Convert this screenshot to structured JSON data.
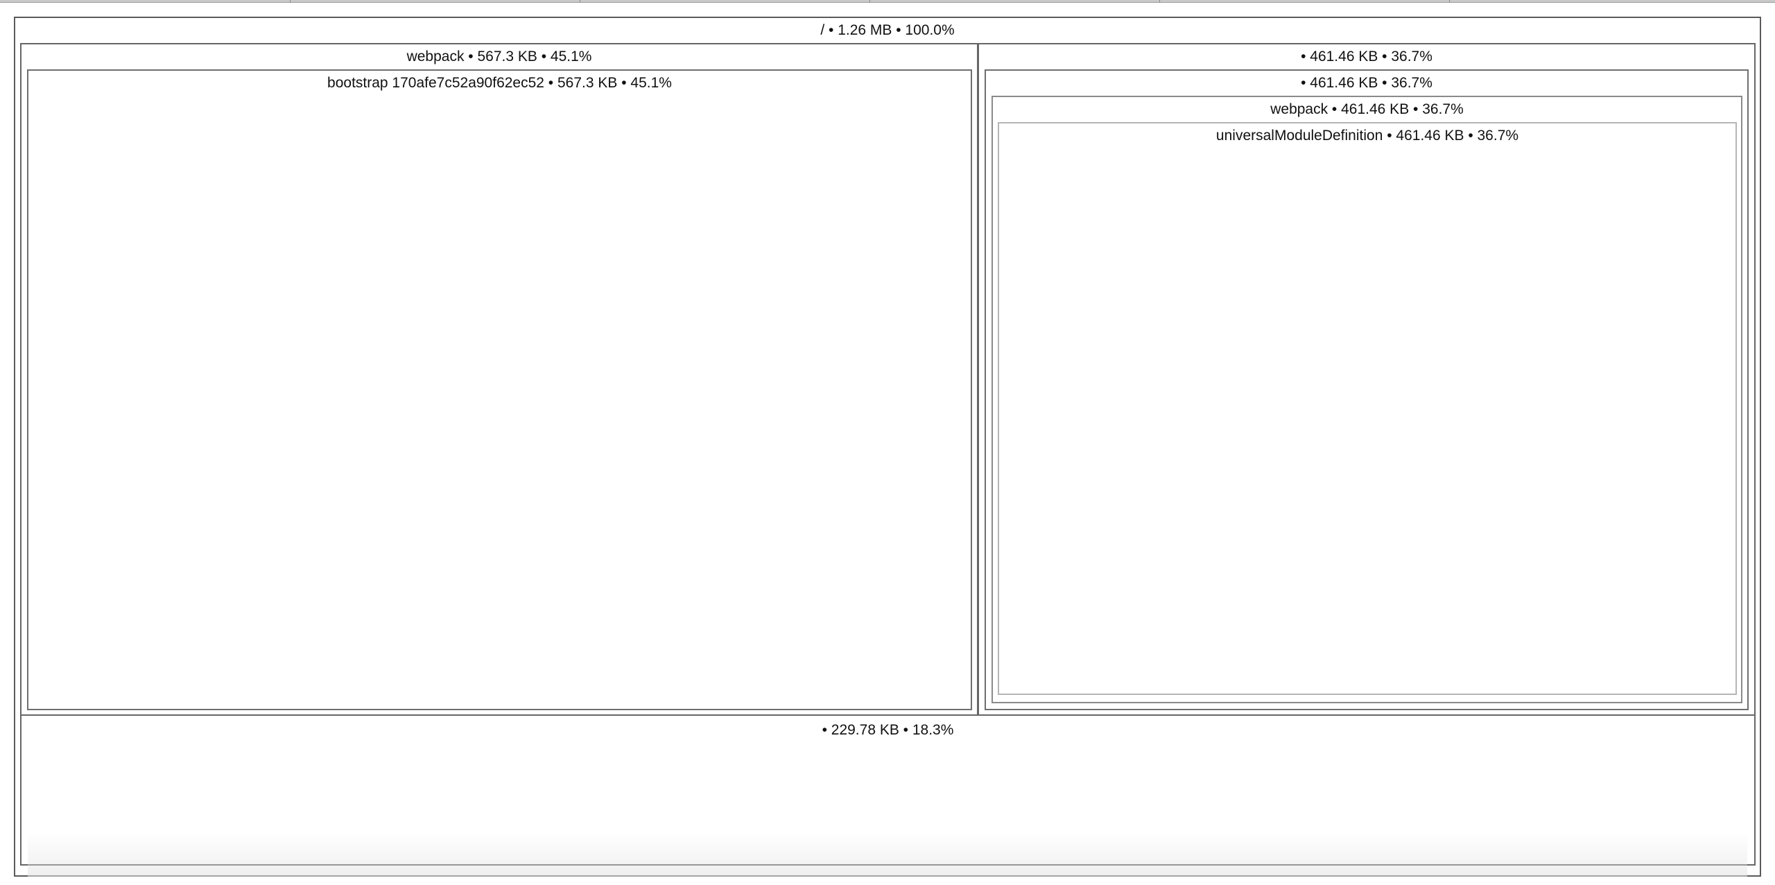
{
  "treemap": {
    "root": {
      "label": "/ • 1.26 MB • 100.0%"
    },
    "webpack_group": {
      "label": "webpack • 567.3 KB • 45.1%"
    },
    "bootstrap_chunk": {
      "label": "bootstrap 170afe7c52a90f62ec52 • 567.3 KB • 45.1%"
    },
    "unnamed_group_right": {
      "label": "• 461.46 KB • 36.7%"
    },
    "unnamed_subgroup_right": {
      "label": "• 461.46 KB • 36.7%"
    },
    "webpack_right": {
      "label": "webpack • 461.46 KB • 36.7%"
    },
    "umd": {
      "label": "universalModuleDefinition • 461.46 KB • 36.7%"
    },
    "unnamed_bottom": {
      "label": "• 229.78 KB • 18.3%"
    }
  }
}
